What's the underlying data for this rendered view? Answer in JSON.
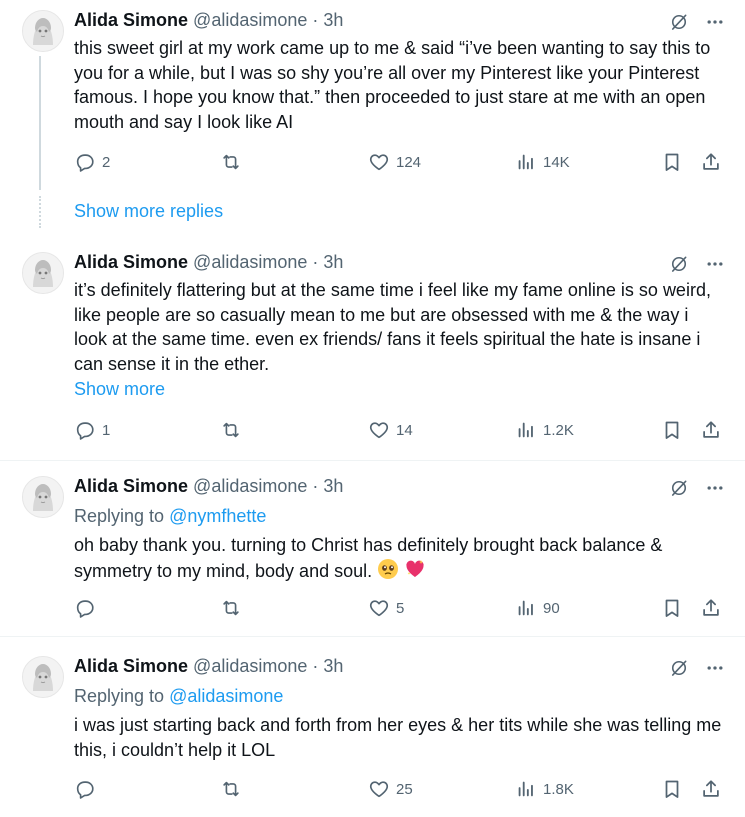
{
  "author": {
    "name": "Alida Simone",
    "handle": "@alidasimone",
    "separator": "·"
  },
  "show_more_replies_label": "Show more replies",
  "show_more_label": "Show more",
  "replying_to_label": "Replying to",
  "tweets": [
    {
      "time": "3h",
      "text": "this sweet girl at my work came up to me & said “i’ve been wanting to say this to you for a while, but I was so shy you’re all over my Pinterest like your Pinterest famous. I hope you know that.” then proceeded to just stare at me with an open mouth and say I look like AI",
      "replies": "2",
      "reposts": "",
      "likes": "124",
      "views": "14K"
    },
    {
      "time": "3h",
      "text": "it’s definitely flattering but at the same time i feel like my fame online is so weird, like people are so casually mean to me but are obsessed with me & the way i look at the same time. even ex friends/ fans it feels spiritual the hate is insane i can sense it in the ether.",
      "replies": "1",
      "reposts": "",
      "likes": "14",
      "views": "1.2K"
    },
    {
      "time": "3h",
      "replying_to": "@nymfhette",
      "text": "oh baby thank you. turning to Christ has definitely brought back balance & symmetry to my mind, body and soul.",
      "replies": "",
      "reposts": "",
      "likes": "5",
      "views": "90"
    },
    {
      "time": "3h",
      "replying_to": "@alidasimone",
      "text": "i was just starting back and forth from her eyes & her tits while she was telling me this, i couldn’t help it LOL",
      "replies": "",
      "reposts": "",
      "likes": "25",
      "views": "1.8K"
    }
  ],
  "icons": {
    "reply": "reply-icon",
    "repost": "repost-icon",
    "like": "heart-icon",
    "views": "views-icon",
    "bookmark": "bookmark-icon",
    "share": "share-icon",
    "grok": "grok-icon",
    "more": "more-icon"
  },
  "colors": {
    "link": "#1d9bf0",
    "secondary": "#536471",
    "text": "#0f1419"
  }
}
